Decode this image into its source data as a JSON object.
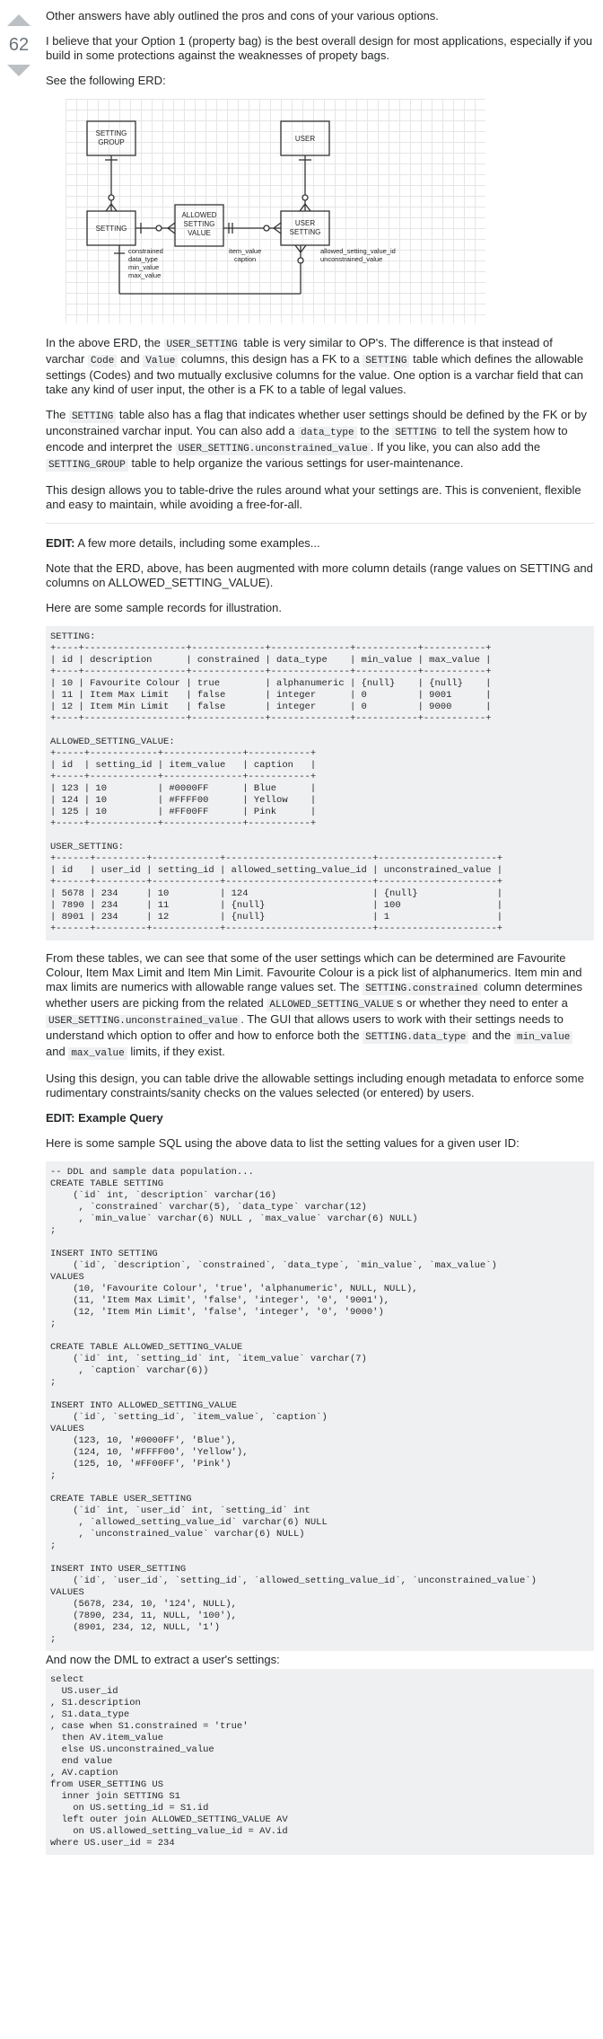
{
  "vote": {
    "count": "62"
  },
  "intro": {
    "p1": "Other answers have ably outlined the pros and cons of your various options.",
    "p2": "I believe that your Option 1 (property bag) is the best overall design for most applications, especially if you build in some protections against the weaknesses of propety bags.",
    "p3": "See the following ERD:"
  },
  "erd": {
    "setting_group": [
      "SETTING",
      "GROUP"
    ],
    "user": "USER",
    "setting": "SETTING",
    "allowed": [
      "ALLOWED",
      "SETTING",
      "VALUE"
    ],
    "user_setting": [
      "USER",
      "SETTING"
    ],
    "setting_cols": [
      "constrained",
      "data_type",
      "min_value",
      "max_value"
    ],
    "allowed_cols": [
      "item_value",
      "caption"
    ],
    "user_setting_cols": [
      "allowed_setting_value_id",
      "unconstrained_value"
    ]
  },
  "para_erd": {
    "t1": "In the above ERD, the ",
    "c1": "USER_SETTING",
    "t2": " table is very similar to OP's. The difference is that instead of varchar ",
    "c2": "Code",
    "t3": " and ",
    "c3": "Value",
    "t4": " columns, this design has a FK to a ",
    "c4": "SETTING",
    "t5": " table which defines the allowable settings (Codes) and two mutually exclusive columns for the value. One option is a varchar field that can take any kind of user input, the other is a FK to a table of legal values."
  },
  "para_flag": {
    "t1": "The ",
    "c1": "SETTING",
    "t2": " table also has a flag that indicates whether user settings should be defined by the FK or by unconstrained varchar input. You can also add a ",
    "c2": "data_type",
    "t3": " to the ",
    "c3": "SETTING",
    "t4": " to tell the system how to encode and interpret the ",
    "c4": "USER_SETTING.unconstrained_value",
    "t5": ". If you like, you can also add the ",
    "c5": "SETTING_GROUP",
    "t6": " table to help organize the various settings for user-maintenance."
  },
  "para_design": "This design allows you to table-drive the rules around what your settings are. This is convenient, flexible and easy to maintain, while avoiding a free-for-all.",
  "edit1": {
    "label": "EDIT:",
    "text": " A few more details, including some examples...",
    "note": "Note that the ERD, above, has been augmented with more column details (range values on SETTING and columns on ALLOWED_SETTING_VALUE).",
    "sample": "Here are some sample records for illustration."
  },
  "records_block": "SETTING:\n+----+------------------+-------------+--------------+-----------+-----------+\n| id | description      | constrained | data_type    | min_value | max_value |\n+----+------------------+-------------+--------------+-----------+-----------+\n| 10 | Favourite Colour | true        | alphanumeric | {null}    | {null}    |\n| 11 | Item Max Limit   | false       | integer      | 0         | 9001      |\n| 12 | Item Min Limit   | false       | integer      | 0         | 9000      |\n+----+------------------+-------------+--------------+-----------+-----------+\n\nALLOWED_SETTING_VALUE:\n+-----+------------+--------------+-----------+\n| id  | setting_id | item_value   | caption   |\n+-----+------------+--------------+-----------+\n| 123 | 10         | #0000FF      | Blue      |\n| 124 | 10         | #FFFF00      | Yellow    |\n| 125 | 10         | #FF00FF      | Pink      |\n+-----+------------+--------------+-----------+\n\nUSER_SETTING:\n+------+---------+------------+--------------------------+---------------------+\n| id   | user_id | setting_id | allowed_setting_value_id | unconstrained_value |\n+------+---------+------------+--------------------------+---------------------+\n| 5678 | 234     | 10         | 124                      | {null}              |\n| 7890 | 234     | 11         | {null}                   | 100                 |\n| 8901 | 234     | 12         | {null}                   | 1                   |\n+------+---------+------------+--------------------------+---------------------+",
  "para_tables": {
    "t1": "From these tables, we can see that some of the user settings which can be determined are Favourite Colour, Item Max Limit and Item Min Limit. Favourite Colour is a pick list of alphanumerics. Item min and max limits are numerics with allowable range values set. The ",
    "c1": "SETTING.constrained",
    "t2": " column determines whether users are picking from the related ",
    "c2": "ALLOWED_SETTING_VALUE",
    "t3": "s or whether they need to enter a ",
    "c3": "USER_SETTING.unconstrained_value",
    "t4": ". The GUI that allows users to work with their settings needs to understand which option to offer and how to enforce both the ",
    "c4": "SETTING.data_type",
    "t5": " and the ",
    "c5": "min_value",
    "t6": " and ",
    "c6": "max_value",
    "t7": " limits, if they exist."
  },
  "para_using": "Using this design, you can table drive the allowable settings including enough metadata to enforce some rudimentary constraints/sanity checks on the values selected (or entered) by users.",
  "edit2": {
    "label": "EDIT: Example Query",
    "text": "Here is some sample SQL using the above data to list the setting values for a given user ID:"
  },
  "sql_ddl": "-- DDL and sample data population...\nCREATE TABLE SETTING\n    (`id` int, `description` varchar(16)\n     , `constrained` varchar(5), `data_type` varchar(12)\n     , `min_value` varchar(6) NULL , `max_value` varchar(6) NULL)\n;\n\nINSERT INTO SETTING\n    (`id`, `description`, `constrained`, `data_type`, `min_value`, `max_value`)\nVALUES\n    (10, 'Favourite Colour', 'true', 'alphanumeric', NULL, NULL),\n    (11, 'Item Max Limit', 'false', 'integer', '0', '9001'),\n    (12, 'Item Min Limit', 'false', 'integer', '0', '9000')\n;\n\nCREATE TABLE ALLOWED_SETTING_VALUE\n    (`id` int, `setting_id` int, `item_value` varchar(7)\n     , `caption` varchar(6))\n;\n\nINSERT INTO ALLOWED_SETTING_VALUE\n    (`id`, `setting_id`, `item_value`, `caption`)\nVALUES\n    (123, 10, '#0000FF', 'Blue'),\n    (124, 10, '#FFFF00', 'Yellow'),\n    (125, 10, '#FF00FF', 'Pink')\n;\n\nCREATE TABLE USER_SETTING\n    (`id` int, `user_id` int, `setting_id` int\n     , `allowed_setting_value_id` varchar(6) NULL\n     , `unconstrained_value` varchar(6) NULL)\n;\n\nINSERT INTO USER_SETTING\n    (`id`, `user_id`, `setting_id`, `allowed_setting_value_id`, `unconstrained_value`)\nVALUES\n    (5678, 234, 10, '124', NULL),\n    (7890, 234, 11, NULL, '100'),\n    (8901, 234, 12, NULL, '1')\n;",
  "dml_intro": "And now the DML to extract a user's settings:",
  "sql_dml": "select\n  US.user_id\n, S1.description\n, S1.data_type\n, case when S1.constrained = 'true'\n  then AV.item_value\n  else US.unconstrained_value\n  end value\n, AV.caption\nfrom USER_SETTING US\n  inner join SETTING S1\n    on US.setting_id = S1.id\n  left outer join ALLOWED_SETTING_VALUE AV\n    on US.allowed_setting_value_id = AV.id\nwhere US.user_id = 234"
}
